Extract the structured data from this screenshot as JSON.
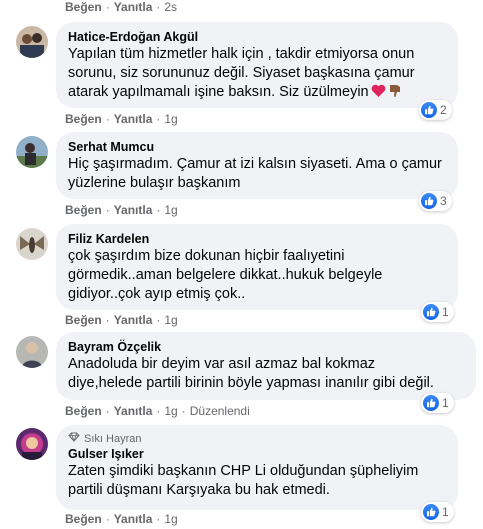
{
  "top_actions": {
    "like": "Beğen",
    "reply": "Yanıtla",
    "time": "2s"
  },
  "comments": [
    {
      "author": "Hatice-Erdoğan Akgül",
      "text": "Yapılan tüm hizmetler halk için , takdir etmiyorsa onun\nsorunu, siz sorununuz değil. Siyaset başkasına çamur\natarak yapılmamalı işine baksın. Siz üzülmeyin",
      "reaction_count": "2",
      "like": "Beğen",
      "reply": "Yanıtla",
      "time": "1g"
    },
    {
      "author": "Serhat Mumcu",
      "text": "Hiç şaşırmadım. Çamur at izi kalsın siyaseti. Ama o çamur\nyüzlerine bulaşır başkanım",
      "reaction_count": "3",
      "like": "Beğen",
      "reply": "Yanıtla",
      "time": "1g"
    },
    {
      "author": "Filiz Kardelen",
      "text": "çok şaşırdım bize dokunan hiçbir faalıyetini\ngörmedik..aman belgelere dikkat..hukuk belgeyle\ngidiyor..çok ayıp etmiş çok..",
      "reaction_count": "1",
      "like": "Beğen",
      "reply": "Yanıtla",
      "time": "1g"
    },
    {
      "author": "Bayram Özçelik",
      "text": "Anadoluda bir deyim var asıl azmaz bal kokmaz\ndiye,helede partili birinin böyle yapması inanılır gibi değil.",
      "reaction_count": "1",
      "like": "Beğen",
      "reply": "Yanıtla",
      "time": "1g",
      "edited": "Düzenlendi"
    },
    {
      "fan_badge": "Sıkı Hayran",
      "author": "Gulser Işıker",
      "text": "Zaten şimdiki başkanın CHP Li olduğundan şüpheliyim\npartili düşmanı Karşıyaka bu hak etmedi.",
      "reaction_count": "1",
      "like": "Beğen",
      "reply": "Yanıtla",
      "time": "1g"
    }
  ],
  "icons": {
    "reaction": "like-icon",
    "emoji_1": "red-heart-emoji",
    "emoji_2": "thumbs-down-emoji",
    "badge": "diamond-icon"
  },
  "colors": {
    "like_blue": "#1877f2",
    "bubble_bg": "#f0f2f5",
    "meta_gray": "#65676b"
  }
}
